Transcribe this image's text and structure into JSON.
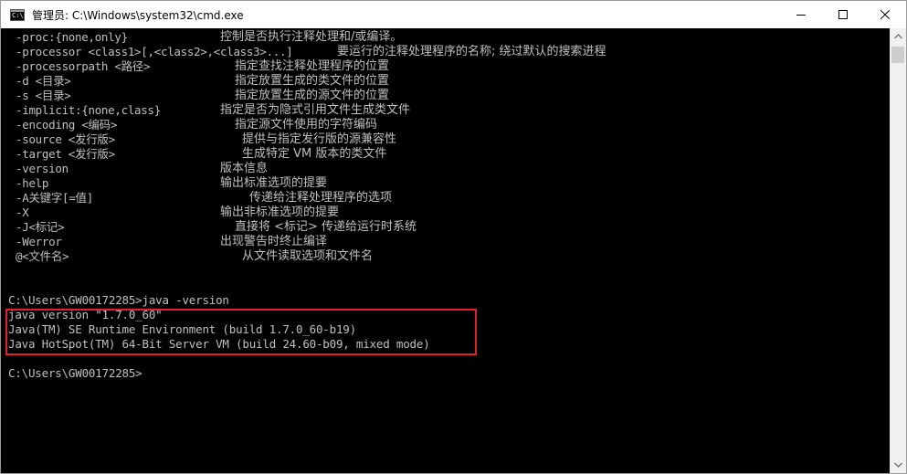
{
  "window": {
    "title": "管理员: C:\\Windows\\system32\\cmd.exe",
    "icon_label": "C:\\",
    "controls": [
      "minimize-icon",
      "maximize-icon",
      "close-icon"
    ]
  },
  "console": {
    "options": [
      {
        "opt": "-proc:{none,only}",
        "desc": "控制是否执行注释处理和/或编译。",
        "indent": 240
      },
      {
        "opt": "-processor <class1>[,<class2>,<class3>...]",
        "desc": "要运行的注释处理程序的名称; 绕过默认的搜索进程",
        "indent": 368
      },
      {
        "opt": "-processorpath <路径>",
        "desc": "指定查找注释处理程序的位置",
        "indent": 256
      },
      {
        "opt": "-d <目录>",
        "desc": "指定放置生成的类文件的位置",
        "indent": 256
      },
      {
        "opt": "-s <目录>",
        "desc": "指定放置生成的源文件的位置",
        "indent": 256
      },
      {
        "opt": "-implicit:{none,class}",
        "desc": "指定是否为隐式引用文件生成类文件",
        "indent": 240
      },
      {
        "opt": "-encoding <编码>",
        "desc": "指定源文件使用的字符编码",
        "indent": 256
      },
      {
        "opt": "-source <发行版>",
        "desc": "提供与指定发行版的源兼容性",
        "indent": 264
      },
      {
        "opt": "-target <发行版>",
        "desc": "生成特定 VM 版本的类文件",
        "indent": 264
      },
      {
        "opt": "-version",
        "desc": "版本信息",
        "indent": 240
      },
      {
        "opt": "-help",
        "desc": "输出标准选项的提要",
        "indent": 240
      },
      {
        "opt": "-A关键字[=值]",
        "desc": "传递给注释处理程序的选项",
        "indent": 272
      },
      {
        "opt": "-X",
        "desc": "输出非标准选项的提要",
        "indent": 240
      },
      {
        "opt": "-J<标记>",
        "desc": "直接将 <标记> 传递给运行时系统",
        "indent": 256
      },
      {
        "opt": "-Werror",
        "desc": "出现警告时终止编译",
        "indent": 240
      },
      {
        "opt": "@<文件名>",
        "desc": "从文件读取选项和文件名",
        "indent": 264
      }
    ],
    "prompt_command": "C:\\Users\\GW00172285>java -version",
    "version_output": [
      "java version \"1.7.0_60\"",
      "Java(TM) SE Runtime Environment (build 1.7.0_60-b19)",
      "Java HotSpot(TM) 64-Bit Server VM (build 24.60-b09, mixed mode)"
    ],
    "prompt_final": "C:\\Users\\GW00172285>"
  },
  "colors": {
    "console_bg": "#000000",
    "console_text": "#c0c0c0",
    "highlight_border": "#e0202a"
  }
}
